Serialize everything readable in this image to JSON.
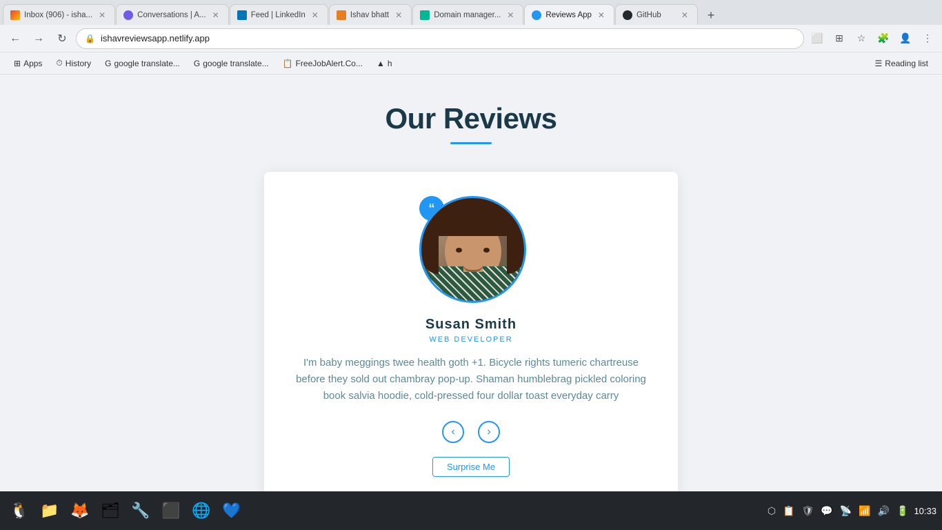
{
  "browser": {
    "tabs": [
      {
        "id": "gmail",
        "title": "Inbox (906) - isha...",
        "favicon_class": "fav-gmail",
        "active": false
      },
      {
        "id": "conversations",
        "title": "Conversations | A...",
        "favicon_class": "fav-conversations",
        "active": false
      },
      {
        "id": "linkedin",
        "title": "Feed | LinkedIn",
        "favicon_class": "fav-linkedin",
        "active": false
      },
      {
        "id": "ishav",
        "title": "Ishav bhatt",
        "favicon_class": "fav-ishav",
        "active": false
      },
      {
        "id": "domain",
        "title": "Domain manager...",
        "favicon_class": "fav-domain",
        "active": false
      },
      {
        "id": "reviews",
        "title": "Reviews App",
        "favicon_class": "fav-reviews",
        "active": true
      },
      {
        "id": "github",
        "title": "GitHub",
        "favicon_class": "fav-github",
        "active": false
      }
    ],
    "address": "ishavreviewsapp.netlify.app",
    "back_disabled": false,
    "forward_disabled": false
  },
  "bookmarks": [
    {
      "label": "Apps",
      "icon": "⊞"
    },
    {
      "label": "History",
      "icon": "⏱"
    },
    {
      "label": "google translate...",
      "icon": "G"
    },
    {
      "label": "google translate...",
      "icon": "G"
    },
    {
      "label": "FreeJobAlert.Co...",
      "icon": "📋"
    },
    {
      "label": "h",
      "icon": "▲"
    }
  ],
  "reading_list": {
    "label": "Reading list",
    "icon": "☰"
  },
  "page": {
    "title": "Our Reviews",
    "reviewer": {
      "name": "Susan Smith",
      "role": "WEB DEVELOPER",
      "review_text": "I'm baby meggings twee health goth +1. Bicycle rights tumeric chartreuse before they sold out chambray pop-up. Shaman humblebrag pickled coloring book salvia hoodie, cold-pressed four dollar toast everyday carry",
      "quote_symbol": "”"
    },
    "nav": {
      "prev_label": "‹",
      "next_label": "›"
    },
    "surprise_btn_label": "Surprise Me"
  },
  "taskbar": {
    "icons": [
      {
        "id": "linux",
        "symbol": "🐧"
      },
      {
        "id": "files",
        "symbol": "📁"
      },
      {
        "id": "firefox",
        "symbol": "🦊"
      },
      {
        "id": "folder",
        "symbol": "🗂"
      },
      {
        "id": "wrench",
        "symbol": "🔧"
      },
      {
        "id": "terminal",
        "symbol": "⬛"
      },
      {
        "id": "chrome",
        "symbol": "🌐"
      },
      {
        "id": "vscode",
        "symbol": "💙"
      }
    ],
    "tray": {
      "bluetooth": "⬡",
      "clipboard": "📋",
      "shield": "🛡",
      "chat": "💬",
      "network": "📡",
      "wifi": "📶",
      "volume": "🔊",
      "battery": "🔋",
      "time": "10:33"
    }
  }
}
